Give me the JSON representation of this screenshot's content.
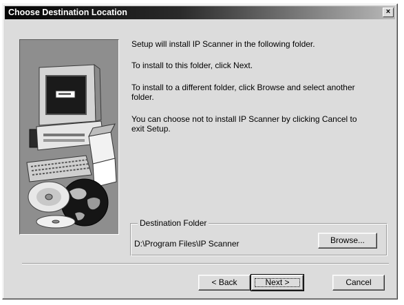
{
  "window": {
    "title": "Choose Destination Location",
    "close_glyph": "×"
  },
  "messages": [
    "Setup will install IP Scanner in the following folder.",
    "To install to this folder, click Next.",
    "To install to a different folder, click Browse and select another",
    "folder.",
    "You can choose not to install IP Scanner by clicking Cancel to",
    "exit Setup."
  ],
  "destination": {
    "legend": "Destination Folder",
    "path": "D:\\Program Files\\IP Scanner",
    "browse_label": "Browse..."
  },
  "buttons": {
    "back_label": "< Back",
    "next_label": "Next >",
    "cancel_label": "Cancel",
    "default_button": "next"
  },
  "art": {
    "icons": [
      "computer-icon",
      "monitor-icon",
      "keyboard-icon",
      "software-box-icon",
      "cd-disc-icon",
      "globe-icon"
    ]
  },
  "colors": {
    "title_start": "#050505",
    "title_end": "#b9b9b9",
    "face": "#dcdcdc",
    "art_background": "#8e8e8e"
  }
}
